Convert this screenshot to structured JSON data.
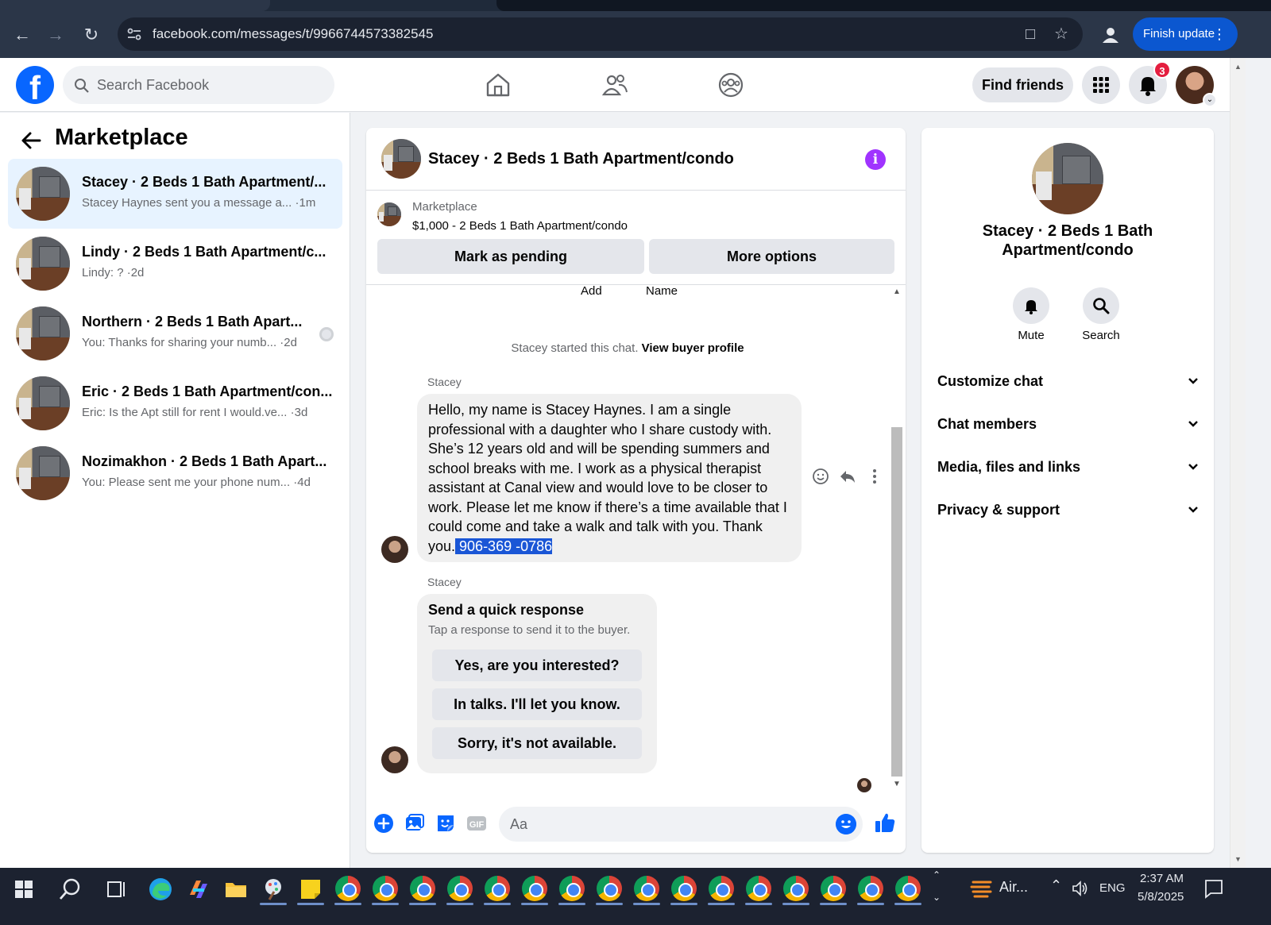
{
  "browser": {
    "url": "facebook.com/messages/t/9966744573382545",
    "finish_update_label": "Finish update"
  },
  "fb_header": {
    "search_placeholder": "Search Facebook",
    "find_friends_label": "Find friends",
    "notification_count": "3"
  },
  "sidebar": {
    "title": "Marketplace",
    "conversations": [
      {
        "name": "Stacey · 2 Beds 1 Bath Apartment/...",
        "preview": "Stacey Haynes sent you a message a... ·1m",
        "active": true
      },
      {
        "name": "Lindy · 2 Beds 1 Bath Apartment/c...",
        "preview": "Lindy: ? ·2d",
        "active": false
      },
      {
        "name": "Northern · 2 Beds 1 Bath Apart...",
        "preview": "You: Thanks for sharing your numb... ·2d",
        "active": false
      },
      {
        "name": "Eric · 2 Beds 1 Bath Apartment/con...",
        "preview": "Eric: Is the Apt still for rent I would.ve... ·3d",
        "active": false
      },
      {
        "name": "Nozimakhon · 2 Beds 1 Bath Apart...",
        "preview": "You: Please sent me your phone num... ·4d",
        "active": false
      }
    ]
  },
  "chat": {
    "title": "Stacey · 2 Beds 1 Bath Apartment/condo",
    "listing_category": "Marketplace",
    "listing_price_title": "$1,000 - 2 Beds 1 Bath Apartment/condo",
    "mark_pending_label": "Mark as pending",
    "more_options_label": "More options",
    "sys_add": "Add",
    "sys_name": "Name",
    "started_text": "Stacey started this chat.",
    "view_buyer_profile": "View buyer profile",
    "sender_1": "Stacey",
    "message_text": "Hello, my name is Stacey Haynes. I am a single professional with a daughter who I share custody with. She’s 12 years old and will be spending summers and school breaks with me. I work as a physical therapist assistant at Canal view and would love to be closer to work. Please let me know if there’s a time available that I could come and take a walk and talk with you. Thank you.",
    "message_phone": " 906-369 -0786",
    "sender_2": "Stacey",
    "quick_title": "Send a quick response",
    "quick_subtitle": "Tap a response to send it to the buyer.",
    "quick_responses": [
      "Yes, are you interested?",
      "In talks. I'll let you know.",
      "Sorry, it's not available."
    ],
    "composer_placeholder": "Aa"
  },
  "info_panel": {
    "title": "Stacey · 2 Beds 1 Bath Apartment/condo",
    "mute_label": "Mute",
    "search_label": "Search",
    "sections": [
      "Customize chat",
      "Chat members",
      "Media, files and links",
      "Privacy & support"
    ]
  },
  "taskbar": {
    "weather_label": "Air...",
    "language": "ENG",
    "time": "2:37 AM",
    "date": "5/8/2025"
  },
  "colors": {
    "fb_blue": "#0866ff",
    "active_conv_bg": "#e7f3ff",
    "info_purple": "#a033ff",
    "badge_red": "#e41e3f",
    "highlight_blue": "#1a56d6"
  }
}
